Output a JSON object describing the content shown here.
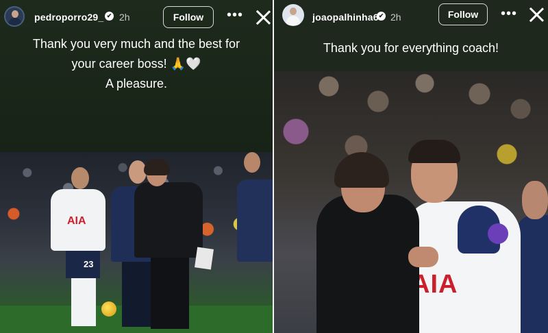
{
  "left_story": {
    "username": "pedroporro29_",
    "verified": "✔",
    "time": "2h",
    "follow_label": "Follow",
    "caption_lines": [
      "Thank you very much and the best for",
      "your career boss! 🙏🤍",
      "A pleasure."
    ],
    "photo": {
      "shirt_sponsor": "AIA",
      "shirt_number": "23"
    }
  },
  "right_story": {
    "username": "joaopalhinha6",
    "verified": "✔",
    "time": "2h",
    "follow_label": "Follow",
    "caption": "Thank you for everything coach!",
    "photo": {
      "shirt_sponsor": "AIA"
    }
  },
  "icons": {
    "more": "more-icon",
    "close": "close-icon",
    "verified": "verified-badge-icon"
  },
  "colors": {
    "left_bg": "#1b271a",
    "right_bg": "#1e281c",
    "sponsor_red": "#cc1f2c",
    "kit_navy": "#1f3166"
  }
}
